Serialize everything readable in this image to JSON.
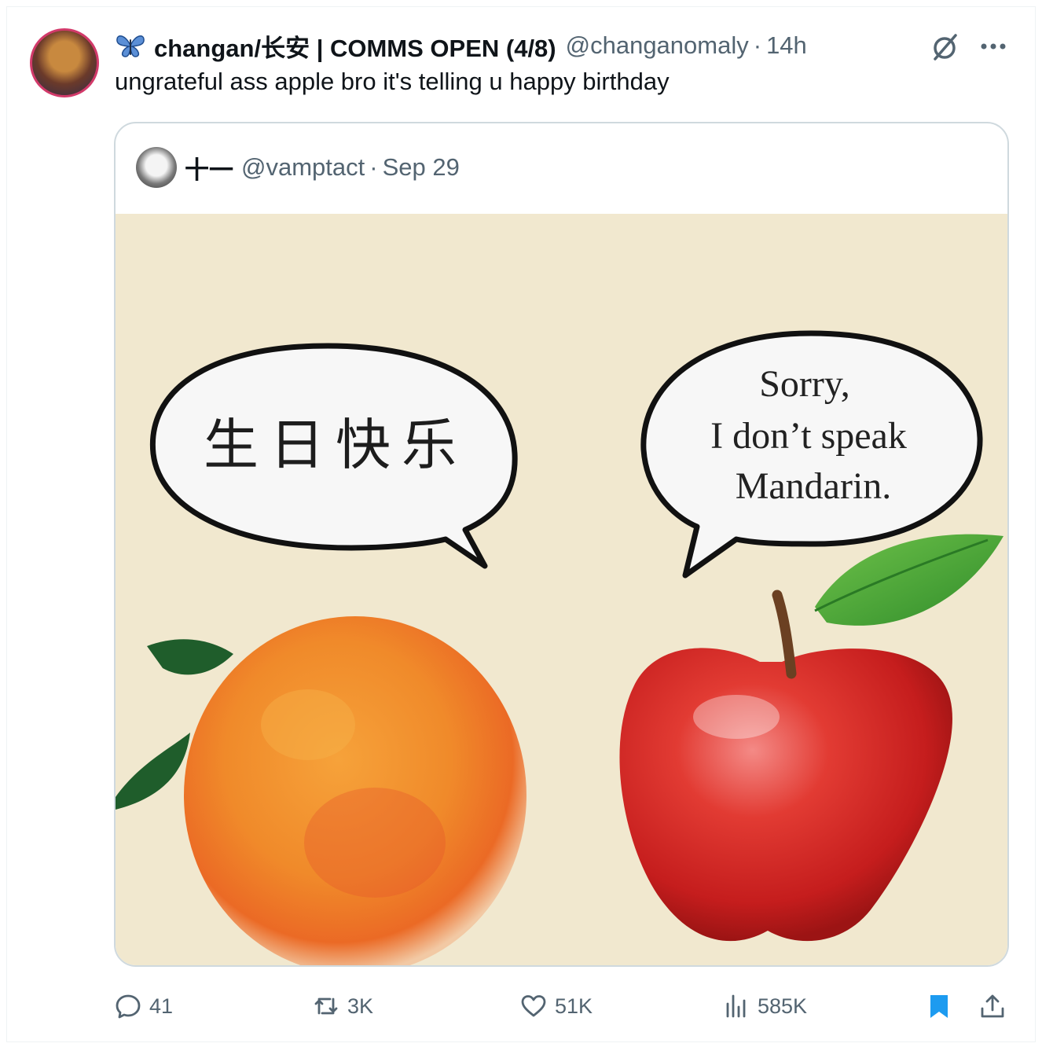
{
  "tweet": {
    "display_name": "changan/长安 | COMMS OPEN (4/8)",
    "handle": "@changanomaly",
    "separator": "·",
    "time": "14h",
    "text": "ungrateful ass apple bro it's telling u happy birthday",
    "icons": {
      "name_emoji": "butterfly-icon",
      "grok": "grok-icon",
      "more": "more-icon"
    }
  },
  "quote": {
    "display_name": "十一",
    "handle": "@vamptact",
    "separator": "·",
    "date": "Sep 29",
    "image": {
      "left_bubble": "生日快乐",
      "right_bubble_lines": [
        "Sorry,",
        "I don’t speak",
        "Mandarin."
      ]
    }
  },
  "actions": {
    "reply_count": "41",
    "retweet_count": "3K",
    "like_count": "51K",
    "views_count": "585K"
  },
  "colors": {
    "text_primary": "#0f1419",
    "text_secondary": "#536471",
    "bookmark_active": "#1d9bf0",
    "border": "#cfd9de",
    "media_bg": "#f1e8cf"
  }
}
